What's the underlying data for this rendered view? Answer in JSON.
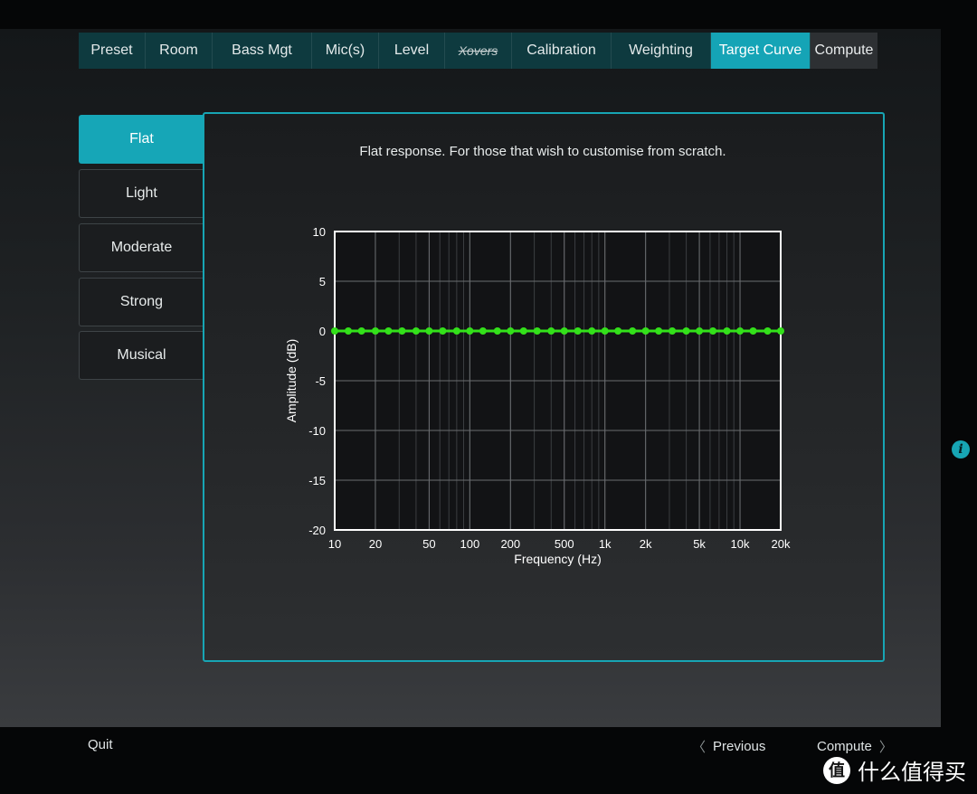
{
  "tabs": [
    {
      "label": "Preset"
    },
    {
      "label": "Room"
    },
    {
      "label": "Bass Mgt"
    },
    {
      "label": "Mic(s)"
    },
    {
      "label": "Level"
    },
    {
      "label": "Xovers"
    },
    {
      "label": "Calibration"
    },
    {
      "label": "Weighting"
    },
    {
      "label": "Target Curve"
    },
    {
      "label": "Compute"
    }
  ],
  "active_tab": "Target Curve",
  "presets": [
    {
      "label": "Flat"
    },
    {
      "label": "Light"
    },
    {
      "label": "Moderate"
    },
    {
      "label": "Strong"
    },
    {
      "label": "Musical"
    }
  ],
  "active_preset": "Flat",
  "description": "Flat response. For those that wish to customise from scratch.",
  "chart_data": {
    "type": "line",
    "xlabel": "Frequency (Hz)",
    "ylabel": "Amplitude (dB)",
    "x_scale": "log",
    "xlim": [
      10,
      20000
    ],
    "ylim": [
      -20,
      10
    ],
    "x_ticks": [
      10,
      20,
      50,
      100,
      200,
      500,
      1000,
      2000,
      5000,
      10000,
      20000
    ],
    "x_tick_labels": [
      "10",
      "20",
      "50",
      "100",
      "200",
      "500",
      "1k",
      "2k",
      "5k",
      "10k",
      "20k"
    ],
    "y_ticks": [
      10,
      5,
      0,
      -5,
      -10,
      -15,
      -20
    ],
    "grid": true,
    "series": [
      {
        "color": "#33e01a",
        "x": [
          10,
          12.6,
          15.8,
          20,
          25,
          31.5,
          40,
          50,
          63,
          80,
          100,
          125,
          160,
          200,
          250,
          315,
          400,
          500,
          630,
          800,
          1000,
          1250,
          1600,
          2000,
          2500,
          3150,
          4000,
          5000,
          6300,
          8000,
          10000,
          12500,
          16000,
          20000
        ],
        "y": [
          0,
          0,
          0,
          0,
          0,
          0,
          0,
          0,
          0,
          0,
          0,
          0,
          0,
          0,
          0,
          0,
          0,
          0,
          0,
          0,
          0,
          0,
          0,
          0,
          0,
          0,
          0,
          0,
          0,
          0,
          0,
          0,
          0,
          0
        ]
      }
    ]
  },
  "footer": {
    "quit": "Quit",
    "previous": "Previous",
    "next": "Compute",
    "chevron_left": "〈",
    "chevron_right": "〉"
  },
  "info_icon": "i",
  "watermark": {
    "logo_glyph": "值",
    "text": "什么值得买"
  },
  "colors": {
    "accent": "#16a6b7",
    "tab_bg": "#0e3a3f",
    "series": "#33e01a"
  }
}
